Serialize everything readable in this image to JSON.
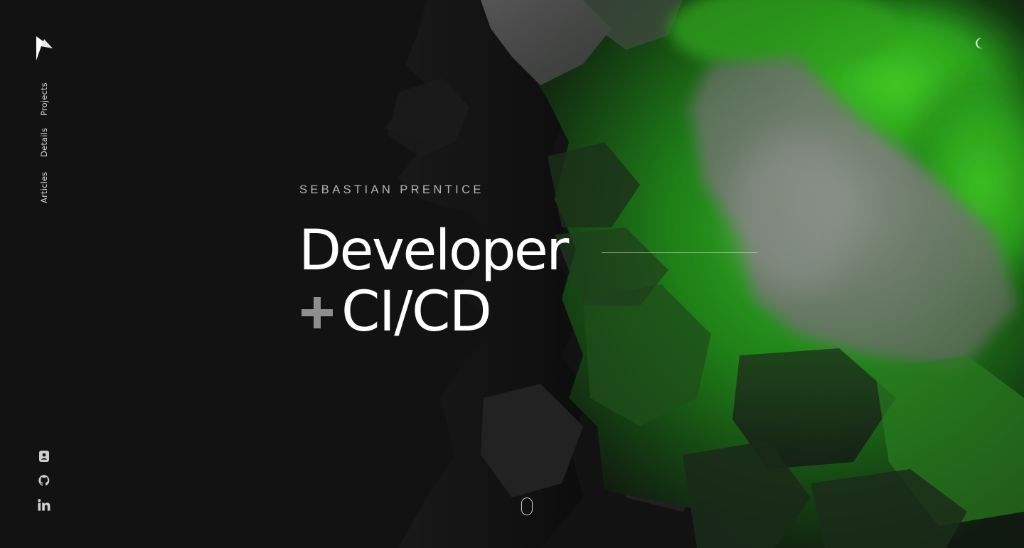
{
  "brand": {
    "logo_icon": "lightning-arrow-logo-icon"
  },
  "nav": {
    "items": [
      {
        "label": "Projects"
      },
      {
        "label": "Details"
      },
      {
        "label": "Articles"
      }
    ]
  },
  "hero": {
    "name": "SEBASTIAN PRENTICE",
    "headline_primary": "Developer",
    "headline_secondary": "CI/CD"
  },
  "theme_toggle": {
    "icon": "moon-icon"
  },
  "social": {
    "icons": [
      "contact-card-icon",
      "github-icon",
      "linkedin-icon"
    ]
  },
  "scroll_indicator": {
    "icon": "mouse-scroll-icon"
  },
  "colors": {
    "background": "#121212",
    "accent": "#29b01f",
    "text": "#ffffff",
    "muted_text": "#b5b5b5",
    "plus": "#8e8e8e"
  }
}
